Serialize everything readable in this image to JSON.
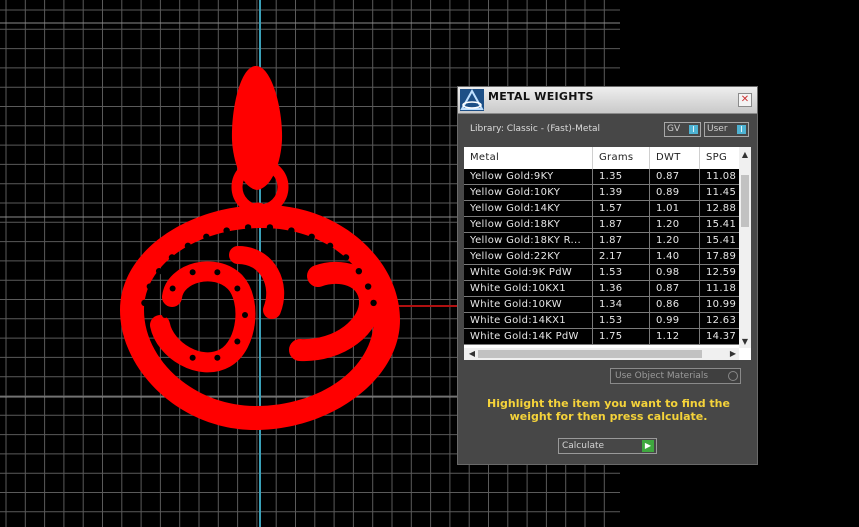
{
  "window": {
    "title": "METAL WEIGHTS",
    "close_glyph": "✕"
  },
  "library": {
    "label": "Library: Classic - (Fast)-Metal",
    "gv_label": "GV",
    "user_label": "User",
    "toggle_glyph": "I"
  },
  "table": {
    "columns": [
      "Metal",
      "Grams",
      "DWT",
      "SPG"
    ],
    "rows": [
      [
        "Yellow Gold:9KY",
        "1.35",
        "0.87",
        "11.08"
      ],
      [
        "Yellow Gold:10KY",
        "1.39",
        "0.89",
        "11.45"
      ],
      [
        "Yellow Gold:14KY",
        "1.57",
        "1.01",
        "12.88"
      ],
      [
        "Yellow Gold:18KY",
        "1.87",
        "1.20",
        "15.41"
      ],
      [
        "Yellow Gold:18KY R...",
        "1.87",
        "1.20",
        "15.41"
      ],
      [
        "Yellow Gold:22KY",
        "2.17",
        "1.40",
        "17.89"
      ],
      [
        "White Gold:9K PdW",
        "1.53",
        "0.98",
        "12.59"
      ],
      [
        "White Gold:10KX1",
        "1.36",
        "0.87",
        "11.18"
      ],
      [
        "White Gold:10KW",
        "1.34",
        "0.86",
        "10.99"
      ],
      [
        "White Gold:14KX1",
        "1.53",
        "0.99",
        "12.63"
      ],
      [
        "White Gold:14K PdW",
        "1.75",
        "1.12",
        "14.37"
      ]
    ],
    "scroll_up": "▲",
    "scroll_down": "▼",
    "scroll_left": "◀",
    "scroll_right": "▶"
  },
  "use_object_materials": "Use Object Materials",
  "instruction": "Highlight the item you want to find the weight for then press calculate.",
  "calculate": {
    "label": "Calculate",
    "glyph": "▶"
  },
  "colors": {
    "background": "#000000",
    "grid_line": "#5a5a5a",
    "axis_y": "#3aa0b8",
    "axis_x": "#b01010",
    "object": "#ff0000",
    "panel": "#474747",
    "instruction": "#f5d33a",
    "accent": "#4eb3d3",
    "go": "#3fa83f"
  },
  "icons": {
    "app": "app-logo-icon",
    "close": "close-icon",
    "calculate": "play-icon"
  }
}
